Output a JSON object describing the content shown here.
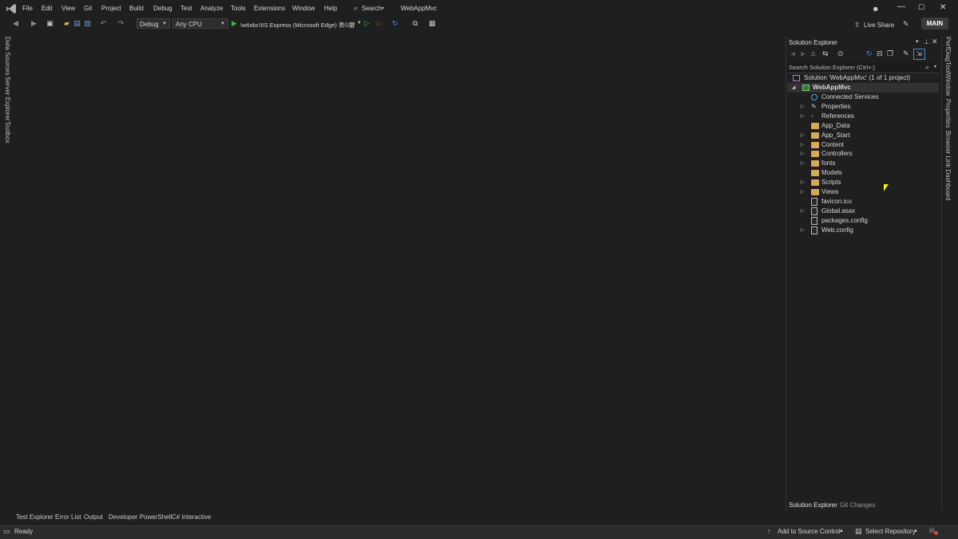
{
  "menu": [
    "File",
    "Edit",
    "View",
    "Git",
    "Project",
    "Build",
    "Debug",
    "Test",
    "Analyze",
    "Tools",
    "Extensions",
    "Window",
    "Help"
  ],
  "search_label": "Search",
  "window_title": "WebAppMvc",
  "live_share": "Live Share",
  "main_badge": "MAIN",
  "toolbar": {
    "config": "Debug",
    "platform": "Any CPU",
    "run_target": "!w6xbc!IIS Express (Microsoft Edge) 表©鍵!"
  },
  "left_tabs": [
    "Data Sources",
    "Server Explorer",
    "Toolbox"
  ],
  "right_tabs": [
    "PerfDiagToolWindow",
    "Properties",
    "Browser Link Dashboard"
  ],
  "solution_explorer": {
    "title": "Solution Explorer",
    "search_placeholder": "Search Solution Explorer (Ctrl+;)",
    "solution_label": "Solution 'WebAppMvc' (1 of 1 project)",
    "project": "WebAppMvc",
    "items": [
      {
        "label": "Connected Services",
        "icon": "connected-services-icon",
        "expandable": false
      },
      {
        "label": "Properties",
        "icon": "wrench-icon",
        "expandable": true
      },
      {
        "label": "References",
        "icon": "references-icon",
        "expandable": true
      },
      {
        "label": "App_Data",
        "icon": "folder-icon",
        "expandable": false
      },
      {
        "label": "App_Start",
        "icon": "folder-icon",
        "expandable": true
      },
      {
        "label": "Content",
        "icon": "folder-icon",
        "expandable": true
      },
      {
        "label": "Controllers",
        "icon": "folder-icon",
        "expandable": true
      },
      {
        "label": "fonts",
        "icon": "folder-icon",
        "expandable": true
      },
      {
        "label": "Models",
        "icon": "folder-icon",
        "expandable": false
      },
      {
        "label": "Scripts",
        "icon": "folder-icon",
        "expandable": true
      },
      {
        "label": "Views",
        "icon": "folder-icon",
        "expandable": true
      },
      {
        "label": "favicon.ico",
        "icon": "file-icon",
        "expandable": false
      },
      {
        "label": "Global.asax",
        "icon": "file-icon",
        "expandable": true
      },
      {
        "label": "packages.config",
        "icon": "file-icon",
        "expandable": false
      },
      {
        "label": "Web.config",
        "icon": "file-icon",
        "expandable": true
      }
    ],
    "bottom_tabs": [
      "Solution Explorer",
      "Git Changes"
    ]
  },
  "bottom_tabs": [
    "Test Explorer",
    "Error List",
    "Output",
    "Developer PowerShell",
    "C# Interactive"
  ],
  "status": {
    "ready": "Ready",
    "add_source_control": "Add to Source Control",
    "select_repository": "Select Repository"
  }
}
